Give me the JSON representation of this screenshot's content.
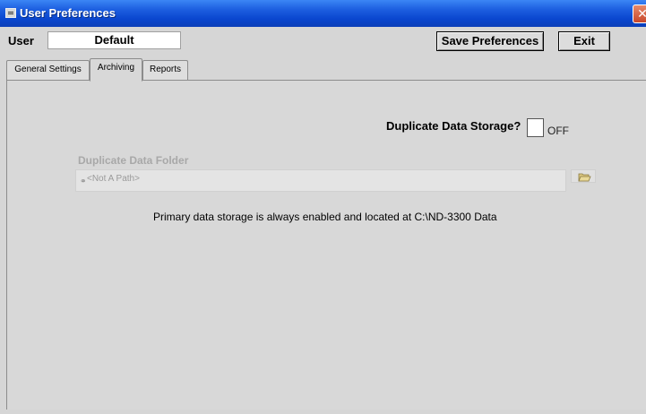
{
  "window": {
    "title": "User Preferences"
  },
  "user": {
    "label": "User",
    "value": "Default"
  },
  "toolbar": {
    "save_label": "Save Preferences",
    "exit_label": "Exit"
  },
  "tabs": [
    {
      "label": "General Settings",
      "selected": false
    },
    {
      "label": "Archiving",
      "selected": true
    },
    {
      "label": "Reports",
      "selected": false
    }
  ],
  "archiving": {
    "duplicate_label": "Duplicate Data Storage?",
    "duplicate_state": "OFF",
    "duplicate_checked": false,
    "folder_label": "Duplicate Data Folder",
    "folder_path": "<Not A Path>",
    "note": "Primary data storage is always enabled and located at C:\\ND-3300 Data"
  },
  "icons": {
    "window": "app-window-icon",
    "close": "close-icon",
    "browse": "folder-open-icon",
    "path": "path-icon"
  },
  "colors": {
    "titlebar": "#0a46cf",
    "background": "#d8d8d8",
    "disabled_text": "#a8a8a8"
  }
}
